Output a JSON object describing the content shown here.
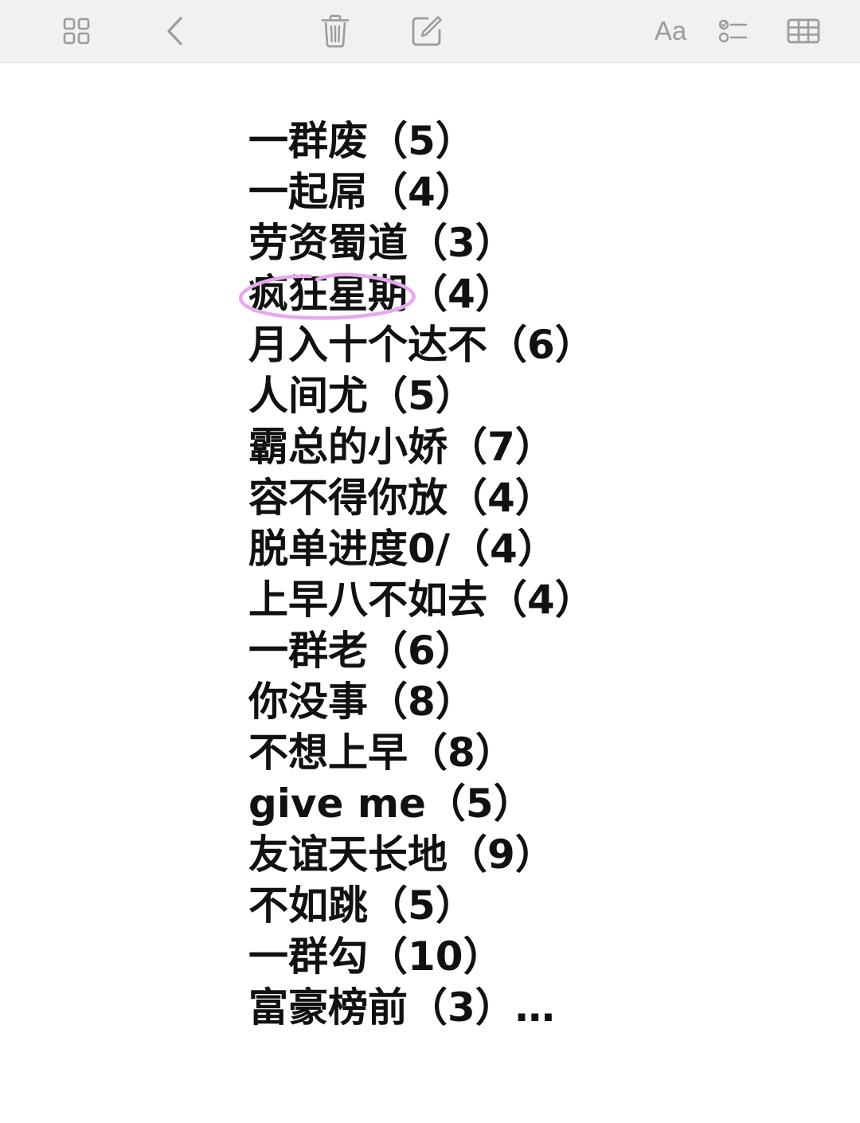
{
  "toolbar": {
    "buttons": [
      {
        "name": "gallery-view-button",
        "icon": "grid-2x2-icon"
      },
      {
        "name": "back-button",
        "icon": "chevron-left-icon"
      },
      {
        "name": "delete-button",
        "icon": "trash-icon"
      },
      {
        "name": "compose-button",
        "icon": "compose-icon"
      },
      {
        "name": "format-button",
        "icon": "text-format-icon",
        "label": "Aa"
      },
      {
        "name": "checklist-button",
        "icon": "checklist-icon"
      },
      {
        "name": "table-button",
        "icon": "table-icon"
      }
    ],
    "icon_color": "#9b9ba0",
    "background": "#f1f1f2"
  },
  "note": {
    "lines": [
      {
        "text": "一群废（5）"
      },
      {
        "text": "一起屌（4）"
      },
      {
        "text": "劳资蜀道（3）"
      },
      {
        "circled": "疯狂星期",
        "rest": "（4）"
      },
      {
        "text": "月入十个达不（6）"
      },
      {
        "text": "人间尤（5）"
      },
      {
        "text": "霸总的小娇（7）"
      },
      {
        "text": "容不得你放（4）"
      },
      {
        "text": "脱单进度0/（4）"
      },
      {
        "text": "上早八不如去（4）"
      },
      {
        "text": "一群老（6）"
      },
      {
        "text": "你没事（8）"
      },
      {
        "text": "不想上早（8）"
      },
      {
        "text": "give me（5）"
      },
      {
        "text": "友谊天长地（9）"
      },
      {
        "text": "不如跳（5）"
      },
      {
        "text": "一群勾（10）"
      },
      {
        "text": "富豪榜前（3）…"
      }
    ],
    "text_color": "#111111",
    "circle_color": "#e7a8ef"
  }
}
